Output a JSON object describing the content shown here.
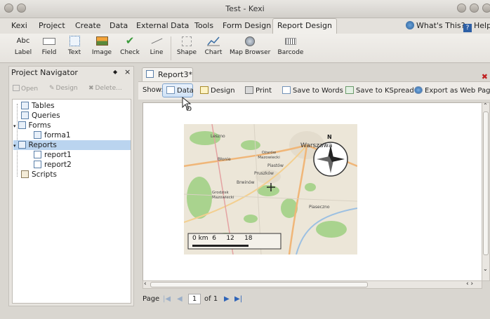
{
  "window": {
    "title": "Test - Kexi"
  },
  "menu": {
    "items": [
      "Kexi",
      "Project",
      "Create",
      "Data",
      "External Data",
      "Tools",
      "Form Design",
      "Report Design"
    ],
    "whats_this": "What's This?",
    "help": "Help"
  },
  "ribbon": {
    "items": [
      {
        "label": "Label",
        "icon": "label-icon"
      },
      {
        "label": "Field",
        "icon": "field-icon"
      },
      {
        "label": "Text",
        "icon": "text-icon"
      },
      {
        "label": "Image",
        "icon": "image-icon"
      },
      {
        "label": "Check",
        "icon": "check-icon"
      },
      {
        "label": "Line",
        "icon": "line-icon"
      },
      {
        "label": "Shape",
        "icon": "shape-icon"
      },
      {
        "label": "Chart",
        "icon": "chart-icon"
      },
      {
        "label": "Map Browser",
        "icon": "map-browser-icon"
      },
      {
        "label": "Barcode",
        "icon": "barcode-icon"
      }
    ],
    "label_glyph": "Abc"
  },
  "navigator": {
    "title": "Project Navigator",
    "tools": {
      "open": "Open",
      "design": "Design",
      "delete": "Delete..."
    },
    "tree": [
      {
        "label": "Tables",
        "level": 0
      },
      {
        "label": "Queries",
        "level": 0
      },
      {
        "label": "Forms",
        "level": 0
      },
      {
        "label": "forma1",
        "level": 1
      },
      {
        "label": "Reports",
        "level": 0,
        "selected": true
      },
      {
        "label": "report1",
        "level": 1
      },
      {
        "label": "report2",
        "level": 1
      },
      {
        "label": "Scripts",
        "level": 0
      }
    ]
  },
  "document": {
    "tab_label": "Report3*",
    "show_label": "Show:",
    "buttons": {
      "data": "Data",
      "design": "Design",
      "print": "Print",
      "save_words": "Save to Words",
      "save_kspread": "Save to KSpread",
      "export_web": "Export as Web Page"
    },
    "map": {
      "places": [
        "Leszno",
        "Warszawa",
        "Błonie",
        "Ożarów Mazowiecki",
        "Piastów",
        "Pruszków",
        "Brwinów",
        "Grodzisk Mazowiecki",
        "Piaseczno"
      ],
      "compass_n": "N",
      "scale_text": "0 km  6     12     18"
    },
    "pagebar": {
      "page_label": "Page",
      "current": "1",
      "of_label": "of 1"
    }
  },
  "colors": {
    "accent": "#bad4ef",
    "map_green": "#9fcf86",
    "road_orange": "#f0b678"
  }
}
